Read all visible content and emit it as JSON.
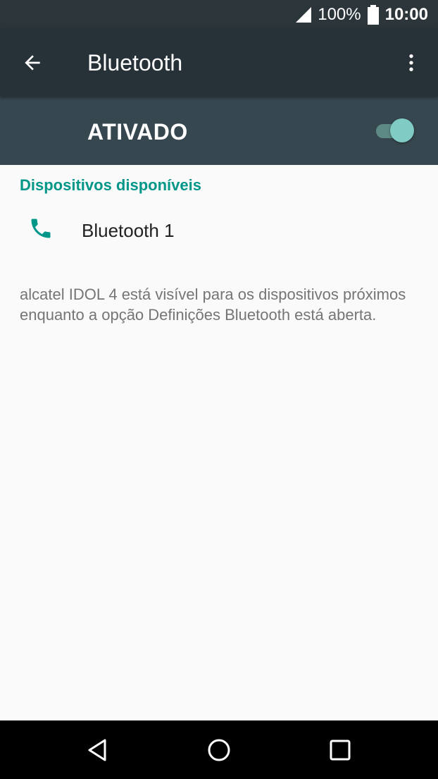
{
  "status_bar": {
    "battery_percent": "100%",
    "time": "10:00",
    "icons": [
      "signal-icon",
      "battery-icon"
    ]
  },
  "app_bar": {
    "title": "Bluetooth",
    "icons": [
      "arrow-back-icon",
      "more-vert-icon"
    ]
  },
  "bluetooth_switch": {
    "label": "ATIVADO",
    "enabled": true
  },
  "available_devices": {
    "header": "Dispositivos disponíveis",
    "devices": [
      {
        "name": "Bluetooth 1",
        "icon": "phone-icon"
      }
    ]
  },
  "visibility_note": "alcatel IDOL 4 está visível para os dispositivos próximos enquanto a opção Definições Bluetooth está aberta.",
  "nav_bar": {
    "icons": [
      "back-triangle-icon",
      "home-circle-icon",
      "recents-square-icon"
    ]
  },
  "colors": {
    "status_bar": "#2b353a",
    "app_bar": "#263238",
    "switch_bar": "#37474f",
    "accent": "#009688",
    "toggle_thumb": "#80cbc4",
    "background": "#fafafa"
  }
}
